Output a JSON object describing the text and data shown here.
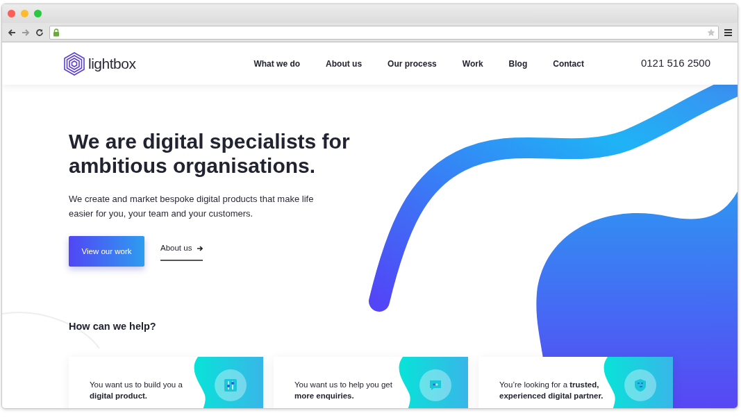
{
  "browser": {
    "address": {
      "secure": true
    }
  },
  "header": {
    "logo": "lightbox",
    "nav": [
      {
        "label": "What we do"
      },
      {
        "label": "About us"
      },
      {
        "label": "Our process"
      },
      {
        "label": "Work"
      },
      {
        "label": "Blog"
      },
      {
        "label": "Contact"
      }
    ],
    "phone": "0121 516 2500"
  },
  "hero": {
    "title": "We are digital specialists for ambitious organisations.",
    "text": "We create and market bespoke digital products that make life easier for you, your team and your customers.",
    "primary_button": "View our work",
    "secondary_link": "About us"
  },
  "help": {
    "title": "How can we help?",
    "cards": [
      {
        "kind": "product",
        "text": "You want us to build you a **digital product.**"
      },
      {
        "kind": "enquiries",
        "text": "You want us to help you get **more enquiries.**"
      },
      {
        "kind": "partner",
        "text": "You’re looking for a **trusted, experienced digital partner.**"
      }
    ]
  }
}
